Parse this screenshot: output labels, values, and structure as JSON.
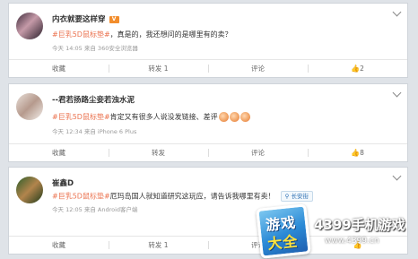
{
  "posts": [
    {
      "user": "内衣就要这样穿",
      "badge": "V",
      "tag": "#巨乳5D鼠标垫#",
      "text": "，真是的，我还想问的是哪里有的卖？",
      "meta": "今天 14:05 来自 360安全浏览器",
      "actions": {
        "fav": "收藏",
        "repost": "转发 1",
        "comment": "评论",
        "like": "2"
      }
    },
    {
      "user": "--君若扬路尘妾若浊水泥",
      "tag": "#巨乳5D鼠标垫#",
      "text": "肯定又有很多人说没发链接、差评",
      "meta": "今天 12:34 来自 iPhone 6 Plus",
      "actions": {
        "fav": "收藏",
        "repost": "转发",
        "comment": "评论",
        "like": "8"
      }
    },
    {
      "user": "崔鑫D",
      "tag": "#巨乳5D鼠标垫#",
      "text": "厄玛岛国人就知道研究这玩应，请告诉我哪里有卖！",
      "location": "长安街",
      "meta": "今天 12:05 来自 Android客户端",
      "actions": {
        "fav": "收藏",
        "repost": "转发 1",
        "comment": "评论",
        "like": ""
      }
    }
  ],
  "logo": {
    "line1": "游戏",
    "line2": "大全",
    "name": "4399手机游戏",
    "url": "www.4399.cn"
  },
  "colors": {
    "tag": "#eb7350",
    "badge": "#f28d2c",
    "location": "#2d6fb3"
  }
}
